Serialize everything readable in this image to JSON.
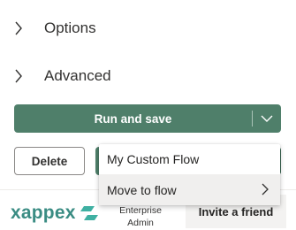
{
  "sections": {
    "options_label": "Options",
    "advanced_label": "Advanced"
  },
  "actions": {
    "run_save_label": "Run and save",
    "delete_label": "Delete"
  },
  "flow_menu": {
    "items": [
      {
        "label": "My Custom Flow",
        "icon": "none"
      },
      {
        "label": "Move to flow",
        "icon": "chevron-right-icon",
        "hovered": true
      }
    ]
  },
  "footer": {
    "logo_text": "xappex",
    "edition_line1": "Enterprise",
    "edition_line2": "Admin",
    "invite_label": "Invite a friend"
  },
  "colors": {
    "primary": "#4f7f6a",
    "primary_dark": "#3e6b57",
    "logo": "#3a8c83",
    "menu_hover": "#f0efee"
  }
}
